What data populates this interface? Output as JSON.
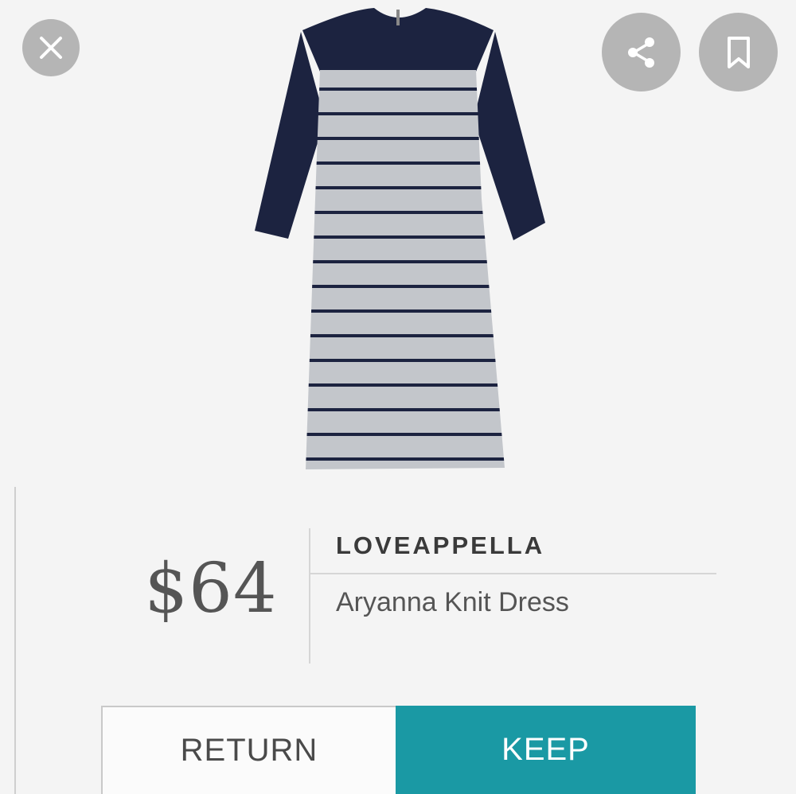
{
  "top_actions": {
    "close_icon": "close-icon",
    "share_icon": "share-icon",
    "save_icon": "bookmark-icon"
  },
  "product": {
    "price": "$64",
    "brand": "LOVEAPPELLA",
    "name": "Aryanna Knit Dress",
    "image": "navy and grey striped three-quarter sleeve dress"
  },
  "actions": {
    "return_label": "RETURN",
    "keep_label": "KEEP"
  },
  "colors": {
    "accent": "#1a99a4",
    "navy": "#1c2340",
    "stripe_bg": "#c3c6cb",
    "icon_bg": "#b5b5b5"
  }
}
